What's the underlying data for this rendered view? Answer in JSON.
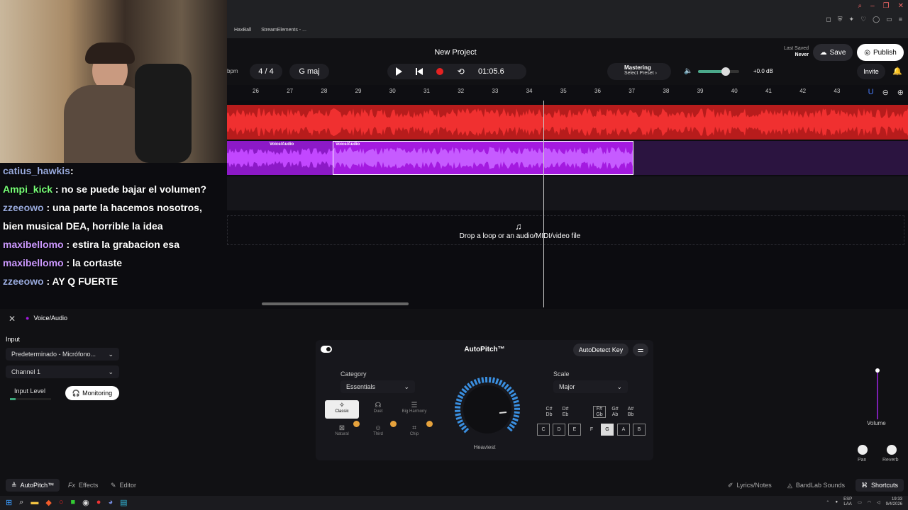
{
  "bookmarks": [
    "HaxBall",
    "StreamElements - ..."
  ],
  "header": {
    "title": "New Project",
    "bpm_unit": "bpm",
    "time_signature": "4 / 4",
    "key": "G maj",
    "timecode": "01:05.6",
    "mastering_title": "Mastering",
    "mastering_sub": "Select Preset ›",
    "volume_db": "+0.0 dB",
    "volume_level": 0.62,
    "last_saved_label": "Last Saved",
    "last_saved_value": "Never",
    "save": "Save",
    "publish": "Publish",
    "invite": "Invite"
  },
  "ruler": [
    "26",
    "27",
    "28",
    "29",
    "30",
    "31",
    "32",
    "33",
    "34",
    "35",
    "36",
    "37",
    "38",
    "39",
    "40",
    "41",
    "42",
    "43"
  ],
  "tracks": {
    "clip_label_1": "Voice/Audio",
    "clip_label_2": "Voice/Audio",
    "drop_text": "Drop a loop or an audio/MIDI/video file"
  },
  "chat": [
    {
      "user": "catius_hawkis",
      "text": ":"
    },
    {
      "user": "Ampi_kick",
      "text": " : no se puede bajar el volumen?"
    },
    {
      "user": "zzeeowo",
      "text": " : una parte la hacemos nosotros, bien musical DEA, horrible la idea"
    },
    {
      "user": "maxibellomo",
      "text": " : estira la grabacion esa"
    },
    {
      "user": "maxibellomo",
      "text": " : la cortaste"
    },
    {
      "user": "zzeeowo",
      "text": " : AY Q FUERTE"
    }
  ],
  "panel": {
    "track_name": "Voice/Audio",
    "input_label": "Input",
    "input_value": "Predeterminado - Micrófono...",
    "channel_value": "Channel 1",
    "input_level_label": "Input Level",
    "monitoring": "Monitoring"
  },
  "autopitch": {
    "title": "AutoPitch™",
    "autodetect": "AutoDetect Key",
    "category_label": "Category",
    "category_value": "Essentials",
    "presets": [
      "Classic",
      "Duet",
      "Big Harmony",
      "Natural",
      "Third",
      "Chip"
    ],
    "knob_label": "Heaviest",
    "scale_label": "Scale",
    "scale_value": "Major",
    "sharps": [
      [
        "C#",
        "Db"
      ],
      [
        "D#",
        "Eb"
      ],
      [
        "F#",
        "Gb"
      ],
      [
        "G#",
        "Ab"
      ],
      [
        "A#",
        "Bb"
      ]
    ],
    "naturals": [
      "C",
      "D",
      "E",
      "F",
      "G",
      "A",
      "B"
    ]
  },
  "mixer": {
    "volume": "Volume",
    "pan": "Pan",
    "reverb": "Reverb"
  },
  "tabs": {
    "autopitch": "AutoPitch™",
    "effects": "Effects",
    "editor": "Editor",
    "lyrics": "Lyrics/Notes",
    "sounds": "BandLab Sounds",
    "shortcuts": "Shortcuts"
  },
  "taskbar": {
    "lang": "ESP",
    "lang2": "LAA",
    "time": "19:33",
    "date": "9/4/2026"
  },
  "colors": {
    "accent": "#a41ae0",
    "record": "#e52222",
    "track_red": "#b71c1c"
  }
}
